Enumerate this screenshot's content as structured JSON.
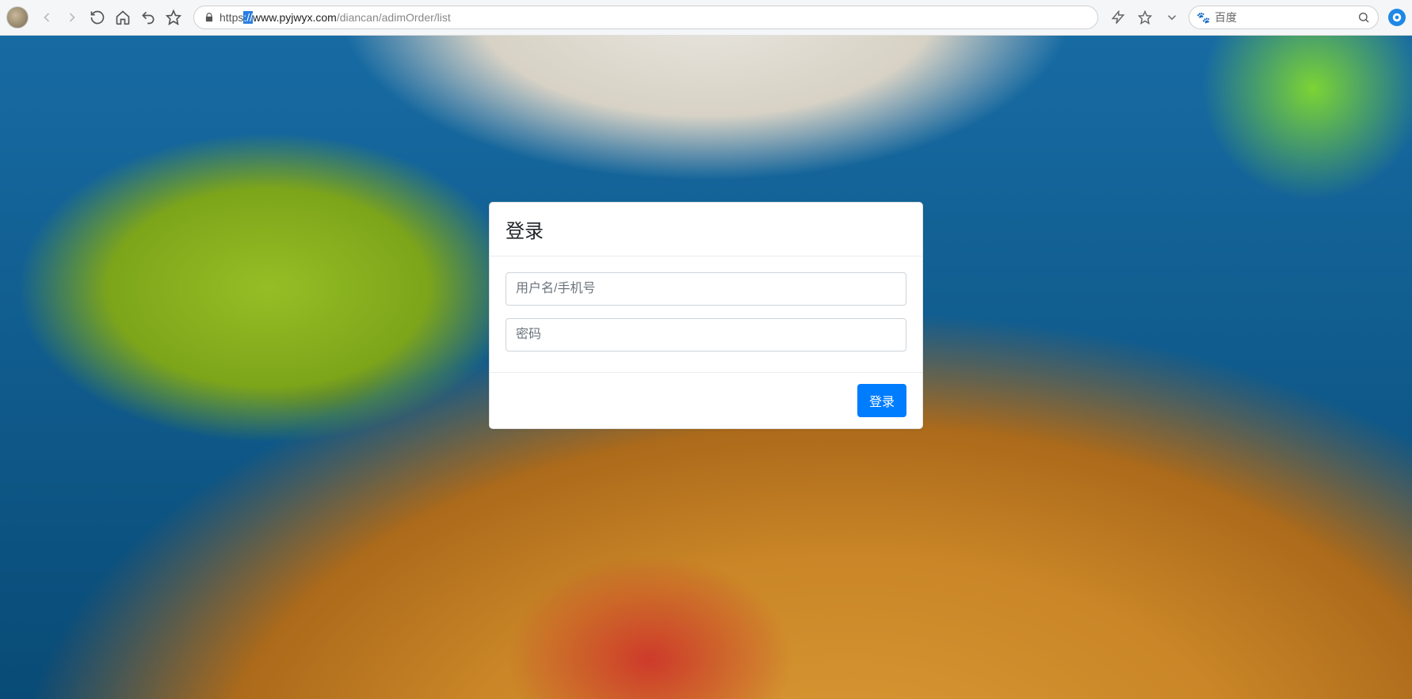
{
  "browser": {
    "url": {
      "scheme": "https",
      "sep": "://",
      "host": "www.pyjwyx.com",
      "path": "/diancan/adimOrder/list"
    },
    "search_engine_label": "百度"
  },
  "login": {
    "title": "登录",
    "username_placeholder": "用户名/手机号",
    "password_placeholder": "密码",
    "submit_label": "登录"
  }
}
